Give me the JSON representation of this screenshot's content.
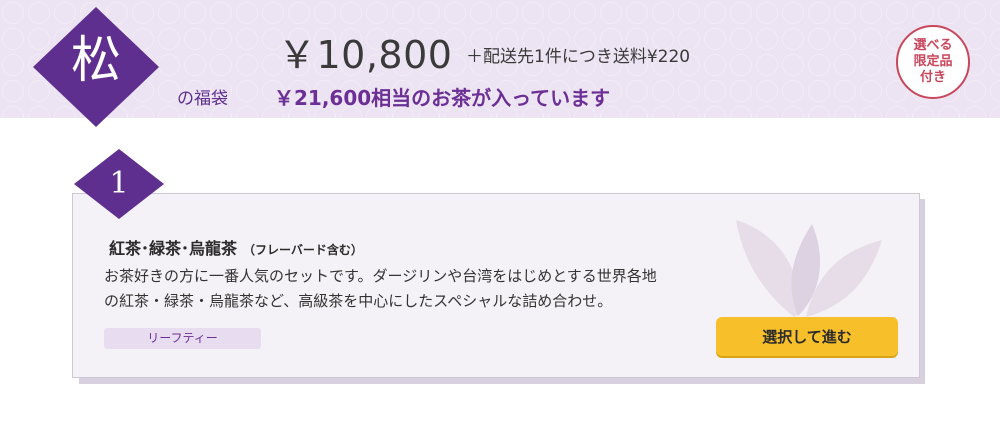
{
  "banner": {
    "rank_char": "松",
    "rank_suffix": "の福袋",
    "price": "￥10,800",
    "shipping_note": "＋配送先1件につき送料¥220",
    "value_note": "￥21,600相当のお茶が入っています",
    "badge_lines": [
      "選べる",
      "限定品",
      "付き"
    ]
  },
  "card": {
    "step_number": "1",
    "title": "紅茶･緑茶･烏龍茶",
    "title_sub": "（フレーバード含む）",
    "description_lines": [
      "お茶好きの方に一番人気のセットです。ダージリンや台湾をはじめとする世界各地",
      "の紅茶・緑茶・烏龍茶など、高級茶を中心にしたスペシャルな詰め合わせ。"
    ],
    "tag": "リーフティー",
    "button_label": "選択して進む"
  },
  "colors": {
    "brand_purple": "#5e2f8e",
    "banner_bg": "#ece4f2",
    "button_yellow": "#f7c02b",
    "badge_red": "#c8475c"
  }
}
